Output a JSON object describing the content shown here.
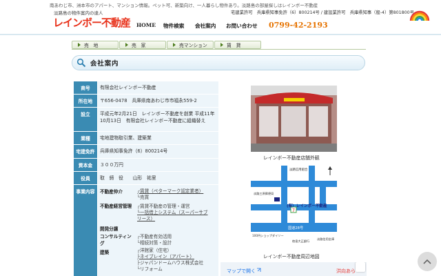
{
  "header": {
    "tagline": "南あわじ市、洲本市のアパート、マンション情報。ペット可、新築向け、一人暮らし物件あり。淡路島の部屋探しはレインボー不動産",
    "brand_sub": "淡路島の物件案内の達人",
    "brand_name": "レインボー不動産",
    "license_line1": "宅建業許可　兵庫県知事免許（6）800214号 / 建設業許可　兵庫県知事（般-4）第801800号",
    "license_line2": "",
    "phone": "0799-42-2193",
    "nav": [
      "HOME",
      "物件検索",
      "会社案内",
      "お問い合わせ"
    ]
  },
  "tabs": [
    "売　地",
    "売　家",
    "売マンション",
    "賃　貸"
  ],
  "section_title": "会社案内",
  "company": {
    "rows": [
      {
        "label": "商号",
        "value": "有限会社レインボー不動産"
      },
      {
        "label": "所在地",
        "value": "〒656-0478　兵庫県南あわじ市市福永559-2"
      },
      {
        "label": "設立",
        "value": "平成元年2月21日　レインボー不動産を創業 平成11年10月13日　有限会社レインボー不動産に組織替え"
      },
      {
        "label": "業種",
        "value": "宅地建物取引業、建築業"
      },
      {
        "label": "宅建免許",
        "value": "兵庫県知事免許（6）800214号"
      },
      {
        "label": "資本金",
        "value": "３００万円"
      },
      {
        "label": "役員",
        "value": "取　締　役　　山形　祐里"
      },
      {
        "label": "事業内容",
        "value": ""
      }
    ],
    "business": [
      {
        "head": "不動産仲介",
        "items": [
          "┌賃貸（ペターマーク認定業者）",
          "└売買"
        ]
      },
      {
        "head": "不動産経営管理",
        "items": [
          "┌賃貸不動産の管理・運営",
          "└一括借上システム（スーパーサブリース）"
        ]
      },
      {
        "head": "開発分譲",
        "items": []
      },
      {
        "head": "コンサルティング",
        "items": [
          "┌不動産有効活用",
          "└相続対策・設計"
        ]
      },
      {
        "head": "建築",
        "items": [
          "┌洋館家（住宅）",
          "├ネイブレイン（アパート）",
          "├ジャパンドームハウス株式会社",
          "└リフォーム"
        ]
      }
    ]
  },
  "photo_caption": "レインボー不動産店舗外観",
  "map": {
    "labels": [
      "淡路信用組合",
      "淡路三原郵便局",
      "(有）レインボー不動産",
      "国道28号",
      "100円ショップダイソー",
      "徳島大正銀行",
      "淡路信用金庫"
    ],
    "caption": "レインボー不動産周辺地図"
  },
  "gmap": {
    "link": "マップで開く",
    "station": "洪向あら"
  },
  "colors": {
    "label_bg": "#3a8bb3",
    "value_bg": "#edf5fa",
    "phone": "#e67300",
    "brand": "#e8311a"
  }
}
